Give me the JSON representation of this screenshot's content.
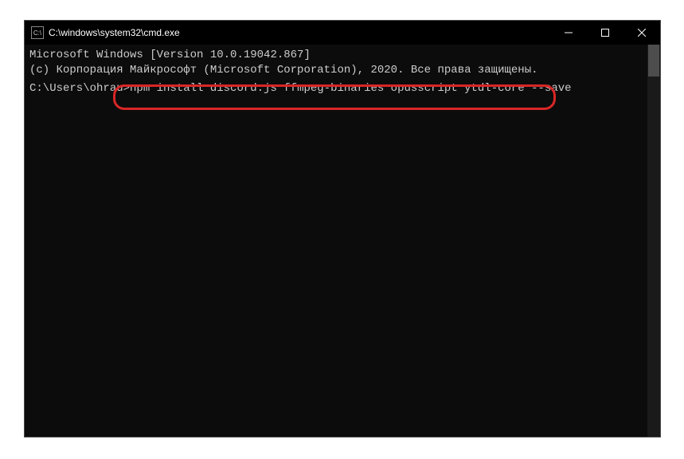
{
  "titlebar": {
    "icon_label": "C:\\",
    "title": "C:\\windows\\system32\\cmd.exe"
  },
  "terminal": {
    "line1": "Microsoft Windows [Version 10.0.19042.867]",
    "line2": "(c) Корпорация Майкрософт (Microsoft Corporation), 2020. Все права защищены.",
    "blank": "",
    "prompt": "C:\\Users\\ohrau>",
    "command": "npm install discord.js ffmpeg-binaries opusscript ytdl-core --save"
  },
  "icons": {
    "minimize": "minimize",
    "maximize": "maximize",
    "close": "close"
  }
}
